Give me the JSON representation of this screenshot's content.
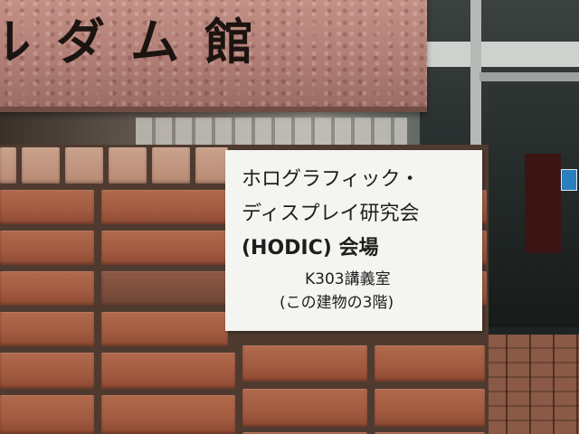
{
  "building_sign": {
    "text": "ルダム館"
  },
  "notice": {
    "line1": "ホログラフィック・",
    "line2": "ディスプレイ研究会",
    "line3": "(HODIC) 会場",
    "line4": "K303講義室",
    "line5": "(この建物の3階)"
  }
}
